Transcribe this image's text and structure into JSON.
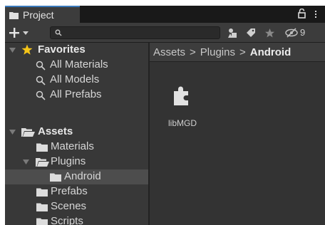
{
  "window": {
    "tab_title": "Project",
    "menu_value": "9"
  },
  "toolbar": {
    "search": {
      "value": "",
      "placeholder": ""
    }
  },
  "tree": {
    "favorites": {
      "label": "Favorites",
      "items": [
        "All Materials",
        "All Models",
        "All Prefabs"
      ]
    },
    "assets": {
      "label": "Assets",
      "children": [
        {
          "label": "Materials"
        },
        {
          "label": "Plugins",
          "children": [
            {
              "label": "Android",
              "selected": true
            }
          ]
        },
        {
          "label": "Prefabs"
        },
        {
          "label": "Scenes"
        },
        {
          "label": "Scripts"
        }
      ]
    }
  },
  "breadcrumb": [
    "Assets",
    "Plugins",
    "Android"
  ],
  "breadcrumb_separator": ">",
  "content": {
    "items": [
      {
        "name": "libMGD",
        "icon": "plugin-icon"
      }
    ]
  },
  "colors": {
    "favorite_star": "#f5c518",
    "tab_accent": "#3a79bb",
    "selection": "#4d4d4d"
  }
}
